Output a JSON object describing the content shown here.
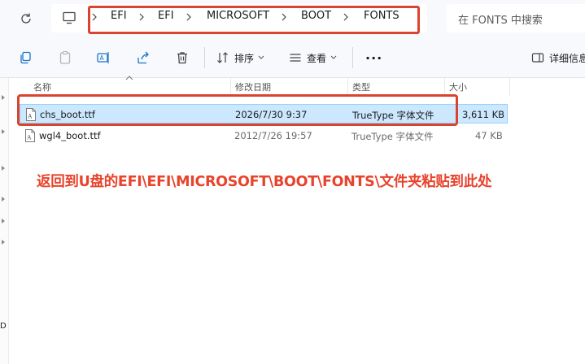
{
  "address_bar": {
    "breadcrumbs": [
      "EFI",
      "EFI",
      "MICROSOFT",
      "BOOT",
      "FONTS"
    ]
  },
  "search": {
    "placeholder": "在 FONTS 中搜索"
  },
  "toolbar": {
    "sort_label": "排序",
    "view_label": "查看",
    "more_label": "···",
    "details_label": "详细信息"
  },
  "file_list": {
    "columns": [
      "名称",
      "修改日期",
      "类型",
      "大小"
    ],
    "rows": [
      {
        "name": "chs_boot.ttf",
        "modified": "2026/7/30 9:37",
        "type": "TrueType 字体文件",
        "size": "3,611 KB",
        "selected": true
      },
      {
        "name": "wgl4_boot.ttf",
        "modified": "2012/7/26 19:57",
        "type": "TrueType 字体文件",
        "size": "47 KB",
        "selected": false
      }
    ]
  },
  "nav_pane": {
    "visible_letter": "D"
  },
  "annotation": {
    "text": "返回到U盘的EFI\\EFI\\MICROSOFT\\BOOT\\FONTS\\文件夹粘贴到此处"
  },
  "colors": {
    "highlight": "#d9442f",
    "annotation_text": "#e8432c",
    "selected_row": "#cce8ff"
  },
  "icons": [
    "refresh-icon",
    "this-pc-icon",
    "chevron-right-icon",
    "copy-icon",
    "paste-icon",
    "rename-icon",
    "share-icon",
    "delete-icon",
    "sort-icon",
    "view-icon",
    "details-pane-icon",
    "font-file-icon"
  ]
}
